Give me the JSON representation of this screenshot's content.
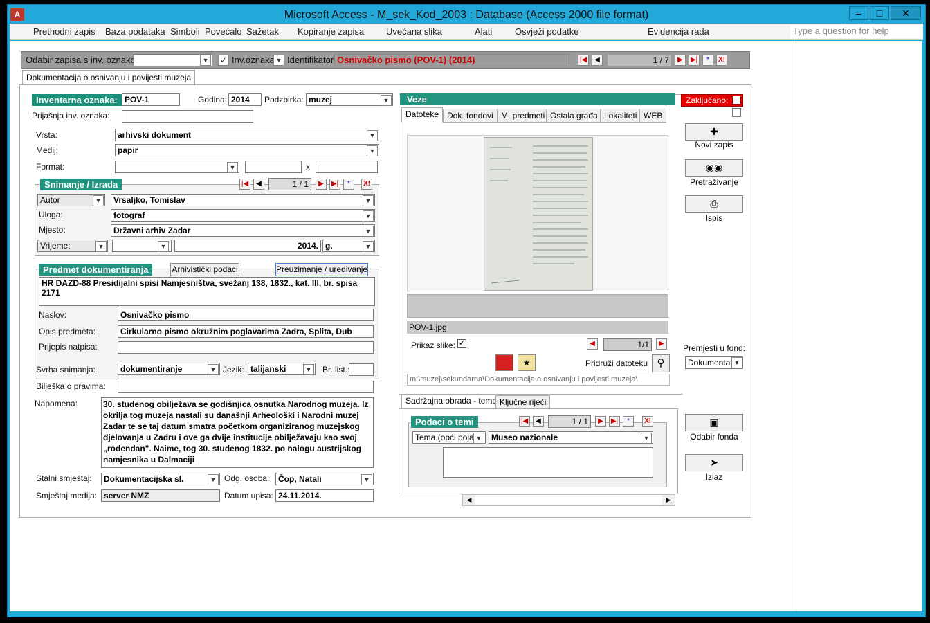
{
  "window": {
    "title": "Microsoft Access - M_sek_Kod_2003 : Database (Access 2000 file format)"
  },
  "menu": {
    "items": [
      "Prethodni zapis",
      "Baza podataka",
      "Simboli",
      "Povećalo",
      "Sažetak",
      "Kopiranje zapisa",
      "Uvećana slika",
      "Alati",
      "Osvježi podatke",
      "Evidencija rada"
    ],
    "help_placeholder": "Type a question for help"
  },
  "navbar": {
    "select_label": "Odabir zapisa s inv. oznakom",
    "inv_label": "Inv.oznaka",
    "id_label": "Identifikator:",
    "id_value": "Osnivačko pismo (POV-1) (2014)",
    "record": "1 / 7"
  },
  "main_tab": "Dokumentacija o osnivanju i povijesti muzeja",
  "form": {
    "inv_label": "Inventarna oznaka:",
    "inv_value": "POV-1",
    "year_label": "Godina:",
    "year_value": "2014",
    "sub_label": "Podzbirka:",
    "sub_value": "muzej",
    "prev_inv_label": "Prijašnja inv. oznaka:",
    "vrsta_label": "Vrsta:",
    "vrsta_value": "arhivski dokument",
    "medij_label": "Medij:",
    "medij_value": "papir",
    "format_label": "Format:",
    "format_x": "x",
    "snim_title": "Snimanje / Izrada",
    "snim_record": "1 / 1",
    "autor_label": "Autor",
    "autor_value": "Vrsaljko, Tomislav",
    "uloga_label": "Uloga:",
    "uloga_value": "fotograf",
    "mjesto_label": "Mjesto:",
    "mjesto_value": "Državni arhiv Zadar",
    "vrijeme_label": "Vrijeme:",
    "vrijeme_value": "2014.",
    "vrijeme_unit": "g.",
    "predmet_title": "Predmet dokumentiranja",
    "arh_btn": "Arhivistički podaci",
    "preuz_btn": "Preuzimanje / uređivanje",
    "predmet_text": "HR DAZD-88 Presidijalni spisi Namjesništva, svežanj 138, 1832., kat. III, br. spisa 2171",
    "naslov_label": "Naslov:",
    "naslov_value": "Osnivačko pismo",
    "opis_label": "Opis predmeta:",
    "opis_value": "Cirkularno pismo okružnim poglavarima Zadra, Splita, Dub",
    "prijepis_label": "Prijepis natpisa:",
    "svrha_label": "Svrha snimanja:",
    "svrha_value": "dokumentiranje",
    "jezik_label": "Jezik:",
    "jezik_value": "talijanski",
    "brlist_label": "Br. list.:",
    "biljeska_label": "Bilješka o pravima:",
    "napomena_label": "Napomena:",
    "napomena_text": "30. studenog obilježava se godišnjica osnutka Narodnog muzeja. Iz okrilja tog muzeja nastali su današnji Arheološki i Narodni muzej Zadar te se taj datum smatra početkom organiziranog muzejskog djelovanja u Zadru i ove ga dvije institucije obilježavaju kao svoj „rođendan\". Naime, tog 30. studenog 1832. po nalogu austrijskog namjesnika u Dalmaciji",
    "stalni_label": "Stalni smještaj:",
    "stalni_value": "Dokumentacijska sl.",
    "odg_label": "Odg. osoba:",
    "odg_value": "Čop, Natali",
    "smj_label": "Smještaj medija:",
    "smj_value": "server NMZ",
    "datum_label": "Datum upisa:",
    "datum_value": "24.11.2014."
  },
  "veze": {
    "title": "Veze",
    "locked_label": "Zaključano:",
    "tabs": [
      "Datoteke",
      "Dok. fondovi",
      "M. predmeti",
      "Ostala građa",
      "Lokaliteti",
      "WEB"
    ],
    "filename": "POV-1.jpg",
    "prikaz_label": "Prikaz slike:",
    "file_record": "1/1",
    "pridruzi_label": "Pridruži datoteku",
    "path": "m:\\muzej\\sekundarna\\Dokumentacija o osnivanju i povijesti muzeja\\"
  },
  "sadrzaj": {
    "tabs": [
      "Sadržajna obrada - teme",
      "Ključne riječi"
    ],
    "title": "Podaci o temi",
    "record": "1 / 1",
    "tema_label": "Tema (opći pojam)",
    "tema_value": "Museo nazionale"
  },
  "side": {
    "novi": "Novi zapis",
    "pretr": "Pretraživanje",
    "ispis": "Ispis",
    "premjesti_label": "Premjesti u fond:",
    "premjesti_value": "Dokumentac",
    "odabir": "Odabir fonda",
    "izlaz": "Izlaz"
  }
}
